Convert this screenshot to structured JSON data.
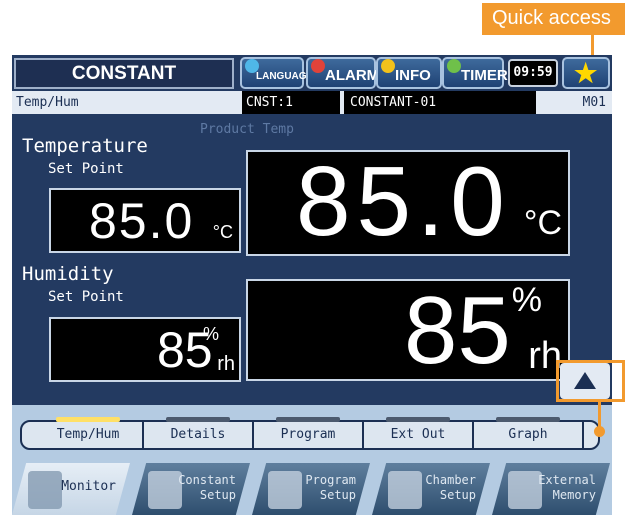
{
  "callouts": {
    "quick_access": "Quick access"
  },
  "header": {
    "title": "CONSTANT",
    "buttons": {
      "language": "LANGUAGE",
      "alarm": "ALARM",
      "info": "INFO",
      "timer": "TIMER"
    },
    "clock": "09:59",
    "quick_access_icon": "star-icon"
  },
  "info_bar": {
    "mode": "Temp/Hum",
    "cnst": "CNST:1",
    "name": "CONSTANT-01",
    "id": "M01"
  },
  "monitor": {
    "product_label": "Product Temp",
    "temperature": {
      "label": "Temperature",
      "set_point_label": "Set Point",
      "set_point": "85.0",
      "set_point_unit": "°C",
      "value": "85.0",
      "unit": "°C"
    },
    "humidity": {
      "label": "Humidity",
      "set_point_label": "Set Point",
      "set_point": "85",
      "set_point_unit_top": "%",
      "set_point_unit_bottom": "rh",
      "value": "85",
      "unit_top": "%",
      "unit_bottom": "rh"
    }
  },
  "tabs": [
    {
      "label": "Temp/Hum",
      "active": true
    },
    {
      "label": "Details",
      "active": false
    },
    {
      "label": "Program",
      "active": false
    },
    {
      "label": "Ext Out",
      "active": false
    },
    {
      "label": "Graph",
      "active": false
    }
  ],
  "menu": [
    {
      "label": "Monitor",
      "active": true
    },
    {
      "label": "Constant\nSetup",
      "active": false
    },
    {
      "label": "Program\nSetup",
      "active": false
    },
    {
      "label": "Chamber\nSetup",
      "active": false
    },
    {
      "label": "External\nMemory",
      "active": false
    }
  ],
  "colors": {
    "screen_bg": "#233a61",
    "callout": "#f29a2e",
    "active_tab_bar": "#ffe066",
    "star": "#ffd800"
  }
}
